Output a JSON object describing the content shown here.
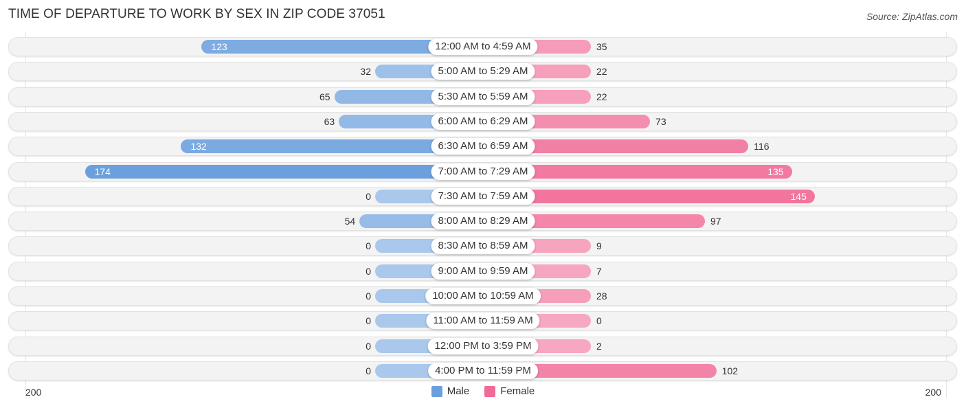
{
  "title": "TIME OF DEPARTURE TO WORK BY SEX IN ZIP CODE 37051",
  "source": "Source: ZipAtlas.com",
  "colors": {
    "male": "#6ca0dc",
    "male_light": "#a9c8ec",
    "female": "#f06b96",
    "female_light": "#f7a8c1"
  },
  "chart_data": {
    "type": "bar",
    "orientation": "horizontal-diverging",
    "title": "TIME OF DEPARTURE TO WORK BY SEX IN ZIP CODE 37051",
    "categories": [
      "12:00 AM to 4:59 AM",
      "5:00 AM to 5:29 AM",
      "5:30 AM to 5:59 AM",
      "6:00 AM to 6:29 AM",
      "6:30 AM to 6:59 AM",
      "7:00 AM to 7:29 AM",
      "7:30 AM to 7:59 AM",
      "8:00 AM to 8:29 AM",
      "8:30 AM to 8:59 AM",
      "9:00 AM to 9:59 AM",
      "10:00 AM to 10:59 AM",
      "11:00 AM to 11:59 AM",
      "12:00 PM to 3:59 PM",
      "4:00 PM to 11:59 PM"
    ],
    "series": [
      {
        "name": "Male",
        "values": [
          123,
          32,
          65,
          63,
          132,
          174,
          0,
          54,
          0,
          0,
          0,
          0,
          0,
          0
        ]
      },
      {
        "name": "Female",
        "values": [
          35,
          22,
          22,
          73,
          116,
          135,
          145,
          97,
          9,
          7,
          28,
          0,
          2,
          102
        ]
      }
    ],
    "xlim": [
      -200,
      200
    ],
    "axis_labels": {
      "left": "200",
      "right": "200"
    },
    "legend": {
      "position": "bottom-center",
      "entries": [
        "Male",
        "Female"
      ]
    }
  }
}
